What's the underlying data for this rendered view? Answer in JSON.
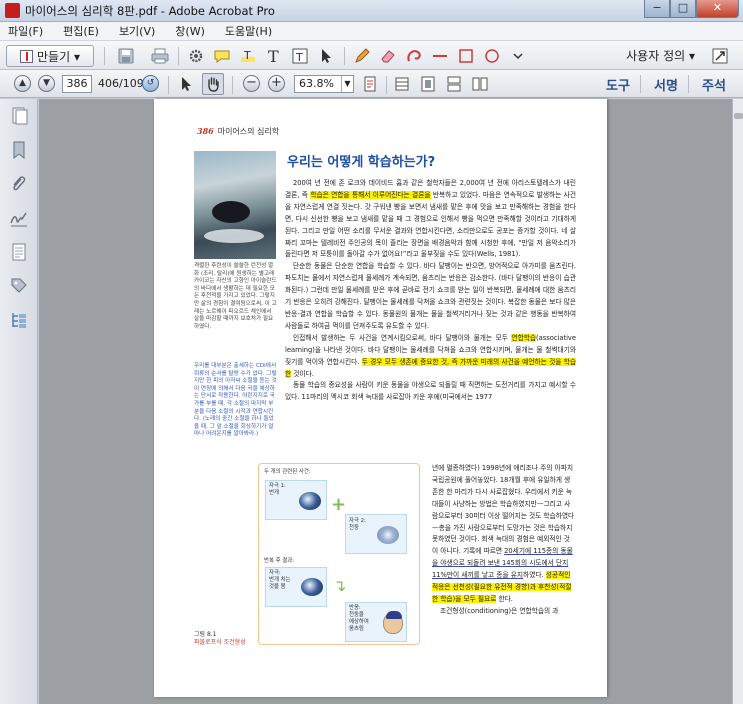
{
  "window": {
    "title": "마이어스의 심리학 8판.pdf - Adobe Acrobat Pro",
    "minimize_label": "−",
    "maximize_label": "□",
    "close_label": "✕"
  },
  "menu": [
    "파일(F)",
    "편집(E)",
    "보기(V)",
    "창(W)",
    "도움말(H)"
  ],
  "toolbar": {
    "create_label": "만들기 ▾",
    "user_defined_label": "사용자 정의 ▾"
  },
  "nav": {
    "page_value": "386",
    "page_count": "406/1093",
    "zoom_value": "63.8%",
    "zoom_dropdown": "▼"
  },
  "panel_tabs": [
    "도구",
    "서명",
    "주석"
  ],
  "page": {
    "running_head_num": "386",
    "running_head_text": "마이어스의 심리학",
    "heading": "우리는 어떻게 학습하는가?",
    "photo_caption": "격렬한 후련성이 쓸쓸한 런천성 멸화 (조리, 탈리)에 원생하는 별고래 카이코는 자신의 고향인 아이슬란드의 바다에서 생활하는 데 필요한 모든 후천적을 가지고 있었다. 그렇지만 삶의 경험이 결여됨으로써, 이 고래는 노르웨이 피오르드 체인에서 살을 마감할 때까지 보호처가 필요하였다.",
    "side_note": "우리를 대부분은 출세하는 CDI에서 쥐류의 순서를 탈랑 수가 없다. 그렇지만 한 피의 아저씨 소절을 듣는 것이 연장에 의해서 다음 곡을 예상하는 단서로 작용한다. 어린지지로 국가를 부를 때, 각 소절의 마지막 부분을 다음 소절의 시작과 연합시킨다. (노래의 중간 소절을 하나 들었을 때, 그 앞 소절을 회상하기가 얼마나 어려운지를 알아봐라.)",
    "para1_a": "200여 년 전에 존 로크와 데이비드 흄과 같은 철학자들은 2,000여 년 전에 아리스토텔레스가 내린 결론, 즉 ",
    "para1_hl": "학습은 연합을 통해서 이루어진다는 결론을",
    "para1_b": " 반복하고 있었다. 마음은 연속적으로 발생하는 사건을 자연스럽게 연결 짓는다. 갓 구워낸 빵을 보면서 냄새를 맡은 후에 맛을 보고 만족해하는 경험을 한다면, 다시 신선한 빵을 보고 냄새를 맡을 때 그 경험으로 인해서 빵을 먹으면 만족해할 것이라고 기대하게 된다. 그리고 만일 어떤 소리를 무서운 결과와 연합시킨다면, 소리만으로도 공포는 증가할 것이다. 네 살짜리 꼬마는 텔레비전 주인공의 목이 졸리는 장면을 배경음악과 함께 시청한 후에, “만일 저 음악소리가 들린다면 저 모퉁이를 돌아갈 수가 없어요!”라고 울부짖을 수도 있다(Wells, 1981).",
    "para2": "단순한 동물은 단순한 연합을 학습할 수 있다. 바다 달팽이는 반으면, 방어적으로 아가미를 움츠린다. 파도치는 물에서 자연스럽게 물세례가 계속되면, 움츠리는 반응은 감소한다. (바다 달팽이의 반응이 습관화된다.) 그런데 만일 물세례를 받은 후에 곧바로 전기 쇼크를 받는 일이 반복되면, 물세례에 대한 움츠리기 반응은 오히려 강해진다. 달팽이는 물세례를 닥쳐올 쇼크와 관련짓는 것이다. 복잡한 동물은 보다 많은 반응-결과 연합을 학습할 수 있다. 동물원의 물개는 물을 철썩거리거나 짖는 것과 같은 행동을 반복하여 사람들로 하여금 먹이를 던져주도록 유도할 수 있다.",
    "para3_a": "인접해서 발생하는 두 사건을 연계시킴으로써, 바다 달팽이와 물개는 모두 ",
    "para3_hl1": "연합학습",
    "para3_b": "(associative learning)을 나타낸 것이다. 바다 달팽이는 물세례를 닥쳐올 쇼크와 연합시키며, 물개는 물 철썩대기와 짖기를 먹이와 연합시킨다. ",
    "para3_hl2": "두 경우 모두 생존에 중요한 것, 즉 가까운 미래의 사건을 예언하는 것을 학습한",
    "para3_c": " 것이다.",
    "para4": "동물 학습의 중요성을 사람이 키운 동물을 야생으로 되돌릴 때 직면하는 도전거리를 가지고 예시할 수 있다. 11마리의 멕시코 회색 늑대를 사로잡아 키운 후에(미국에서는 1977",
    "col2_a": "년에 멸종하였다) 1998년에 애리조나 주의 아파치 국립공원에 풀어놓았다. 18개월 후에 유일하게 생존한 한 마리가 다시 사로잡혔다. 우리에서 키운 늑대들이 사냥하는 방법은 학습하였지만—그리고 사람으로부터 30미터 이상 떨어지는 것도 학습하였다—총을 가진 사람으로부터 도망가는 것은 학습하지 못하였던 것이다. 회색 늑대의 경험은 예외적인 것이 아니다. 기록에 따르면 ",
    "col2_ul": "20세기에 115종의 동물을 야생으로 되돌려 보낸 145회의 시도에서 단지 11%만이 새끼를 낳고 종을 유지",
    "col2_b": "하였다. ",
    "col2_hl": "성공적인 적응은 선천성(필요한 유전적 경향)과 후천성(적절한 학습)을 모두 필요로",
    "col2_c": " 한다.",
    "col2_last": "조건형성(conditioning)은 연합학습의 과",
    "fig": {
      "top_label": "두 개의 관련된 사건:",
      "stim1": "자극 1:\n번개",
      "stim2": "자극 2:\n천둥",
      "after_label": "반복 후 결과:",
      "stim3": "자극:\n번개 치는\n것을 봄",
      "response": "반응:\n천둥을\n예상하여\n움츠림"
    },
    "figure_caption_1": "그림 8.1",
    "figure_caption_2": "파블로프식 조건형성"
  }
}
